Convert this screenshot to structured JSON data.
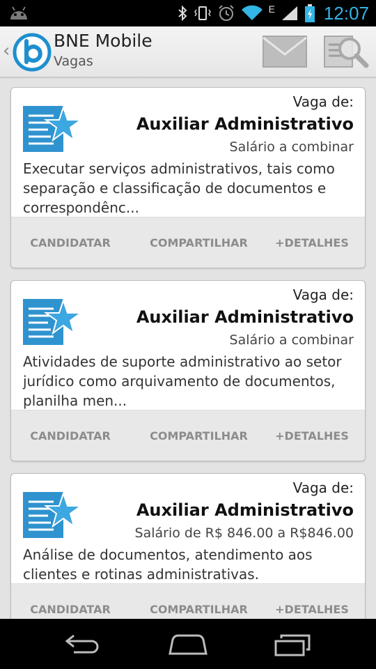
{
  "status_bar": {
    "time": "12:07",
    "network_label": "E"
  },
  "action_bar": {
    "title": "BNE Mobile",
    "subtitle": "Vagas",
    "icons": [
      "up-caret-icon",
      "bne-logo",
      "mail-icon",
      "search-icon"
    ]
  },
  "jobs": [
    {
      "label": "Vaga de:",
      "title": "Auxiliar Administrativo",
      "salary": "Salário a combinar",
      "description": "Executar serviços administrativos, tais como separação e classificação de documentos e correspondênc...",
      "actions": {
        "apply": "CANDIDATAR",
        "share": "COMPARTILHAR",
        "details": "+DETALHES"
      }
    },
    {
      "label": "Vaga de:",
      "title": "Auxiliar Administrativo",
      "salary": "Salário a combinar",
      "description": "Atividades de suporte administrativo ao setor jurídico como arquivamento de documentos, planilha men...",
      "actions": {
        "apply": "CANDIDATAR",
        "share": "COMPARTILHAR",
        "details": "+DETALHES"
      }
    },
    {
      "label": "Vaga de:",
      "title": "Auxiliar Administrativo",
      "salary": "Salário de R$ 846.00 a R$846.00",
      "description": "Análise de documentos, atendimento aos clientes e rotinas administrativas.",
      "actions": {
        "apply": "CANDIDATAR",
        "share": "COMPARTILHAR",
        "details": "+DETALHES"
      }
    }
  ],
  "colors": {
    "accent": "#33b5e5",
    "job_icon_blue": "#2f93cf",
    "card_bg": "#ffffff",
    "list_bg": "#e3e3e3",
    "action_text": "#8c8c8c"
  }
}
